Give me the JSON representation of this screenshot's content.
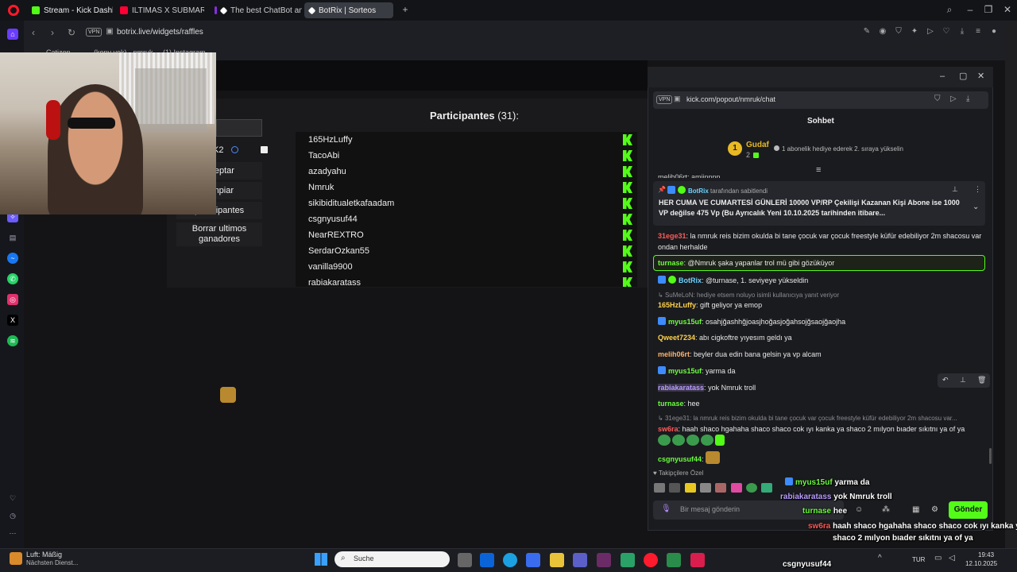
{
  "browser": {
    "tabs": [
      {
        "label": "Stream - Kick Dashboard",
        "color": "#53fc18"
      },
      {
        "label": "ILTIMAS X SUBMARIN",
        "color": "#ff0033"
      },
      {
        "label": "The best ChatBot and Wi",
        "color": "#8a2be2"
      },
      {
        "label": "BotRix | Sorteos",
        "color": "#ffffff"
      }
    ],
    "url": "botrix.live/widgets/raffles",
    "vpn_label": "VPN",
    "bookmarks": [
      "Catizen",
      "(kony yok) - nmruk",
      "(1) Instagram"
    ]
  },
  "raffle": {
    "participants_label": "Participantes",
    "participants_count": "(31):",
    "options": [
      "Aceptar",
      "Limpiar",
      "participantes",
      "Borrar ultimos ganadores"
    ],
    "option_prefix_k": "K2",
    "participants": [
      "165HzLuffy",
      "TacoAbi",
      "azadyahu",
      "Nmruk",
      "sikibiditualetkafaadam",
      "csgnyusuf44",
      "NearREXTRO",
      "SerdarOzkan55",
      "vanilla9900",
      "rabiakaratass"
    ]
  },
  "popout": {
    "url": "kick.com/popout/nmruk/chat",
    "title": "Sohbet",
    "leader": {
      "rank": "1",
      "name": "Gudaf",
      "count": "2",
      "hint": "1 abonelik hediye ederek 2. sıraya yükselin"
    },
    "cut_top": "melih06rt: amiinnnn",
    "pinned": {
      "by": "BotRix",
      "suffix": "tarafından sabitlendi",
      "text": "HER CUMA VE CUMARTESİ GÜNLERİ 10000 VP/RP Çekilişi Kazanan Kişi Abone ise 1000 VP değilse 475 Vp (Bu Ayrıcalık Yeni 10.10.2025 tarihinden itibare..."
    },
    "messages": [
      {
        "user": "31ege31",
        "color": "#ff5a5a",
        "text": "la nmruk reis bizim okulda bi tane çocuk var çocuk freestyle küfür edebiliyor 2m shacosu var ondan herhalde"
      },
      {
        "user": "turnase",
        "color": "#6bff3b",
        "text": "@Nmruk şaka yapanlar trol mü gibi gözüküyor"
      },
      {
        "user": "BotRix",
        "color": "#6bd3ff",
        "text": "@turnase, 1. seviyeye yükseldin"
      },
      {
        "reply": "SuMeLoN: hediye etsem noluyo isimli kullanıcıya yanıt veriyor"
      },
      {
        "user": "165HzLuffy",
        "color": "#ffd24a",
        "text": "gift geliyor ya emop"
      },
      {
        "user": "myus15uf",
        "color": "#6bff3b",
        "text": "osahjğashhğjoasjhoğasjoğahsojğsaojğaojha"
      },
      {
        "user": "Qweet7234",
        "color": "#ffd24a",
        "text": "abı cigkoftre yıyesım geldı ya"
      },
      {
        "user": "melih06rt",
        "color": "#ffb36b",
        "text": "beyler dua edin bana gelsin ya vp alcam"
      },
      {
        "user": "myus15uf",
        "color": "#6bff3b",
        "text": "yarma da"
      },
      {
        "user": "rabiakaratass",
        "color": "#b99cff",
        "text": "yok Nmruk troll"
      },
      {
        "user": "turnase",
        "color": "#6bff3b",
        "text": "hee"
      },
      {
        "reply": "31ege31: la nmruk reis bizim okulda bi tane çocuk var çocuk freestyle küfür edebiliyor 2m shacosu var..."
      },
      {
        "user": "sw6ra",
        "color": "#ff5a5a",
        "text": "haah shaco hgahaha shaco shaco cok ıyı kanka ya shaco 2 mılyon bıader sıkıtnı ya of ya"
      },
      {
        "user": "csgnyusuf44",
        "color": "#6bff3b",
        "text": ""
      }
    ],
    "follower_label": "Takipçilere Özel",
    "input_placeholder": "Bir mesaj gönderin",
    "send_label": "Gönder"
  },
  "overlay_chat": [
    {
      "user": "myus15uf",
      "text": "yarma da",
      "color": "#6bff3b"
    },
    {
      "user": "rabiakaratass",
      "text": "yok Nmruk troll",
      "color": "#b99cff"
    },
    {
      "user": "turnase",
      "text": "hee",
      "color": "#6bff3b"
    },
    {
      "user": "sw6ra",
      "text": "haah shaco hgahaha shaco shaco cok ıyı kanka ya",
      "color": "#ff5a5a"
    },
    {
      "user": "",
      "text": "shaco 2 mılyon bıader sıkıtnı ya of ya",
      "color": "#fff"
    },
    {
      "user": "csgnyusuf44",
      "text": "",
      "color": "#6bff3b"
    }
  ],
  "taskbar": {
    "weather_title": "Luft: Mäßig",
    "weather_sub": "Nächsten Dienst...",
    "search": "Suche",
    "lang": "TUR",
    "time": "19:43",
    "date": "12.10.2025"
  }
}
